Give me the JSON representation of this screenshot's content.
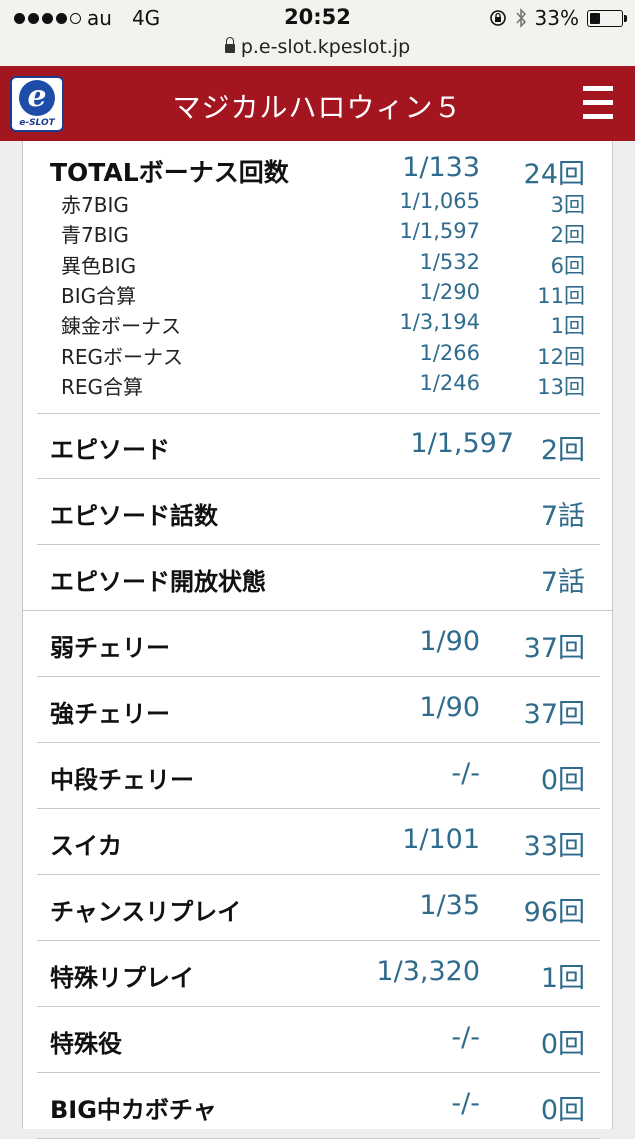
{
  "status_bar": {
    "carrier": "au",
    "network": "4G",
    "time": "20:52",
    "battery": "33%",
    "battery_level": 0.33
  },
  "browser": {
    "url": "p.e-slot.kpeslot.jp"
  },
  "header": {
    "logo_letter": "e",
    "logo_text": "e-SLOT",
    "title": "マジカルハロウィン５"
  },
  "bonus": {
    "total": {
      "label": "TOTALボーナス回数",
      "ratio": "1/133",
      "count": "24回"
    },
    "items": [
      {
        "label": "赤7BIG",
        "ratio": "1/1,065",
        "count": "3回"
      },
      {
        "label": "青7BIG",
        "ratio": "1/1,597",
        "count": "2回"
      },
      {
        "label": "異色BIG",
        "ratio": "1/532",
        "count": "6回"
      },
      {
        "label": "BIG合算",
        "ratio": "1/290",
        "count": "11回"
      },
      {
        "label": "錬金ボーナス",
        "ratio": "1/3,194",
        "count": "1回"
      },
      {
        "label": "REGボーナス",
        "ratio": "1/266",
        "count": "12回"
      },
      {
        "label": "REG合算",
        "ratio": "1/246",
        "count": "13回"
      }
    ]
  },
  "episode": [
    {
      "label": "エピソード",
      "ratio": "1/1,597",
      "count": "2回"
    },
    {
      "label": "エピソード話数",
      "ratio": "",
      "count": "7話"
    },
    {
      "label": "エピソード開放状態",
      "ratio": "",
      "count": "7話"
    }
  ],
  "roles": [
    {
      "label": "弱チェリー",
      "ratio": "1/90",
      "count": "37回"
    },
    {
      "label": "強チェリー",
      "ratio": "1/90",
      "count": "37回"
    },
    {
      "label": "中段チェリー",
      "ratio": "-/-",
      "count": "0回"
    },
    {
      "label": "スイカ",
      "ratio": "1/101",
      "count": "33回"
    },
    {
      "label": "チャンスリプレイ",
      "ratio": "1/35",
      "count": "96回"
    },
    {
      "label": "特殊リプレイ",
      "ratio": "1/3,320",
      "count": "1回"
    },
    {
      "label": "特殊役",
      "ratio": "-/-",
      "count": "0回"
    },
    {
      "label": "BIG中カボチャ",
      "ratio": "-/-",
      "count": "0回"
    }
  ]
}
